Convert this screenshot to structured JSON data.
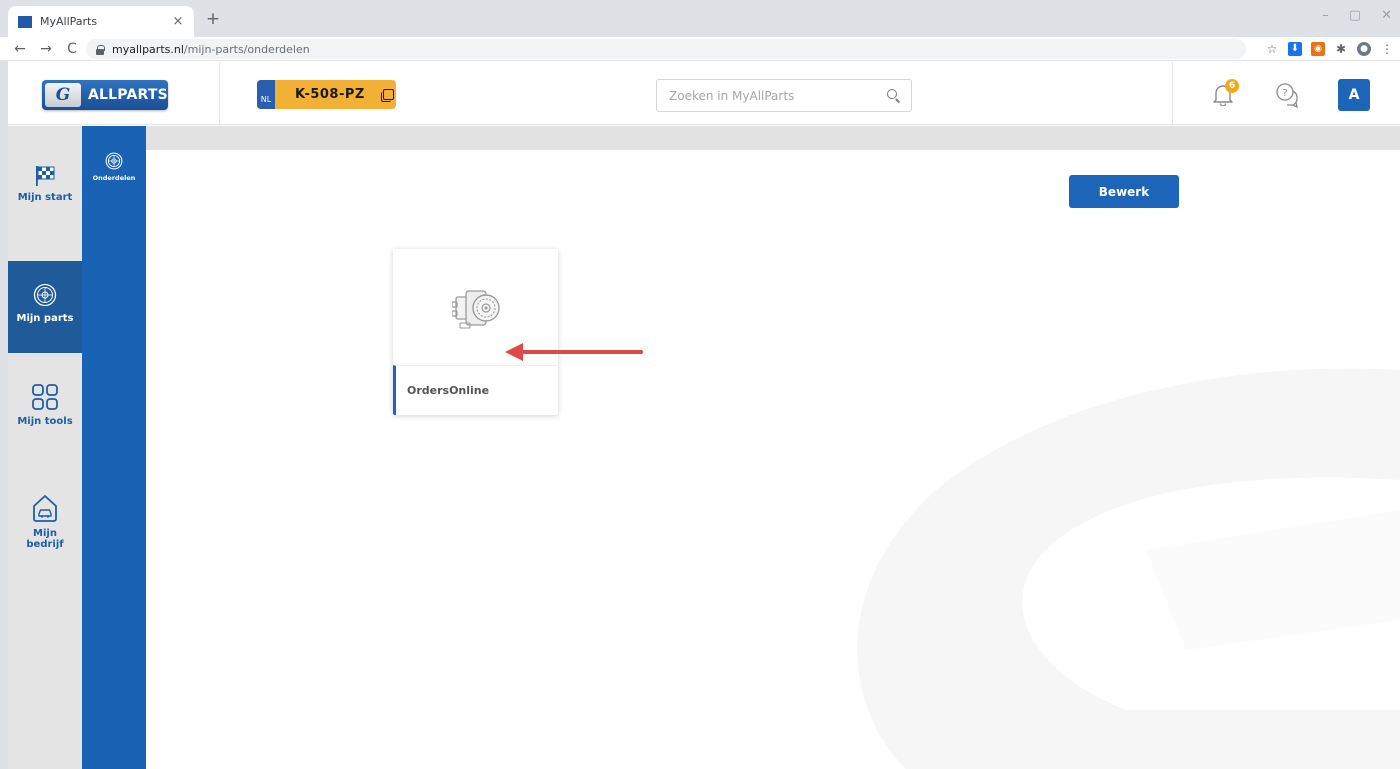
{
  "browser": {
    "tab_title": "MyAllParts",
    "tab_close": "×",
    "new_tab": "+",
    "url_host": "myallparts.nl",
    "url_path": "/mijn-parts/onderdelen",
    "window_controls": [
      "–",
      "▢",
      "✕"
    ]
  },
  "header": {
    "logo_badge": "G",
    "logo_text": "ALLPARTS",
    "plate": {
      "country": "NL",
      "number": "K-508-PZ"
    },
    "search": {
      "placeholder": "Zoeken in MyAllParts",
      "value": ""
    },
    "notifications_count": "6",
    "avatar_initial": "A"
  },
  "sidebar": {
    "items": [
      {
        "label": "Mijn start",
        "icon": "checkered-flag-icon",
        "active": false
      },
      {
        "label": "Mijn parts",
        "icon": "brake-disc-icon",
        "active": true
      },
      {
        "label": "Mijn tools",
        "icon": "grid-icon",
        "active": false
      },
      {
        "label": "Mijn bedrijf",
        "icon": "garage-icon",
        "active": false
      }
    ]
  },
  "subnav": {
    "items": [
      {
        "label": "Onderdelen",
        "icon": "brake-disc-icon"
      }
    ]
  },
  "main": {
    "edit_label": "Bewerk",
    "tiles": [
      {
        "label": "OrdersOnline",
        "icon": "engine-part-icon"
      }
    ]
  },
  "colors": {
    "brand_blue": "#1c65b8",
    "sidebar_active": "#1f5a99",
    "plate_yellow": "#f2b134",
    "badge_orange": "#f2a81d",
    "arrow_red": "#e04848"
  }
}
